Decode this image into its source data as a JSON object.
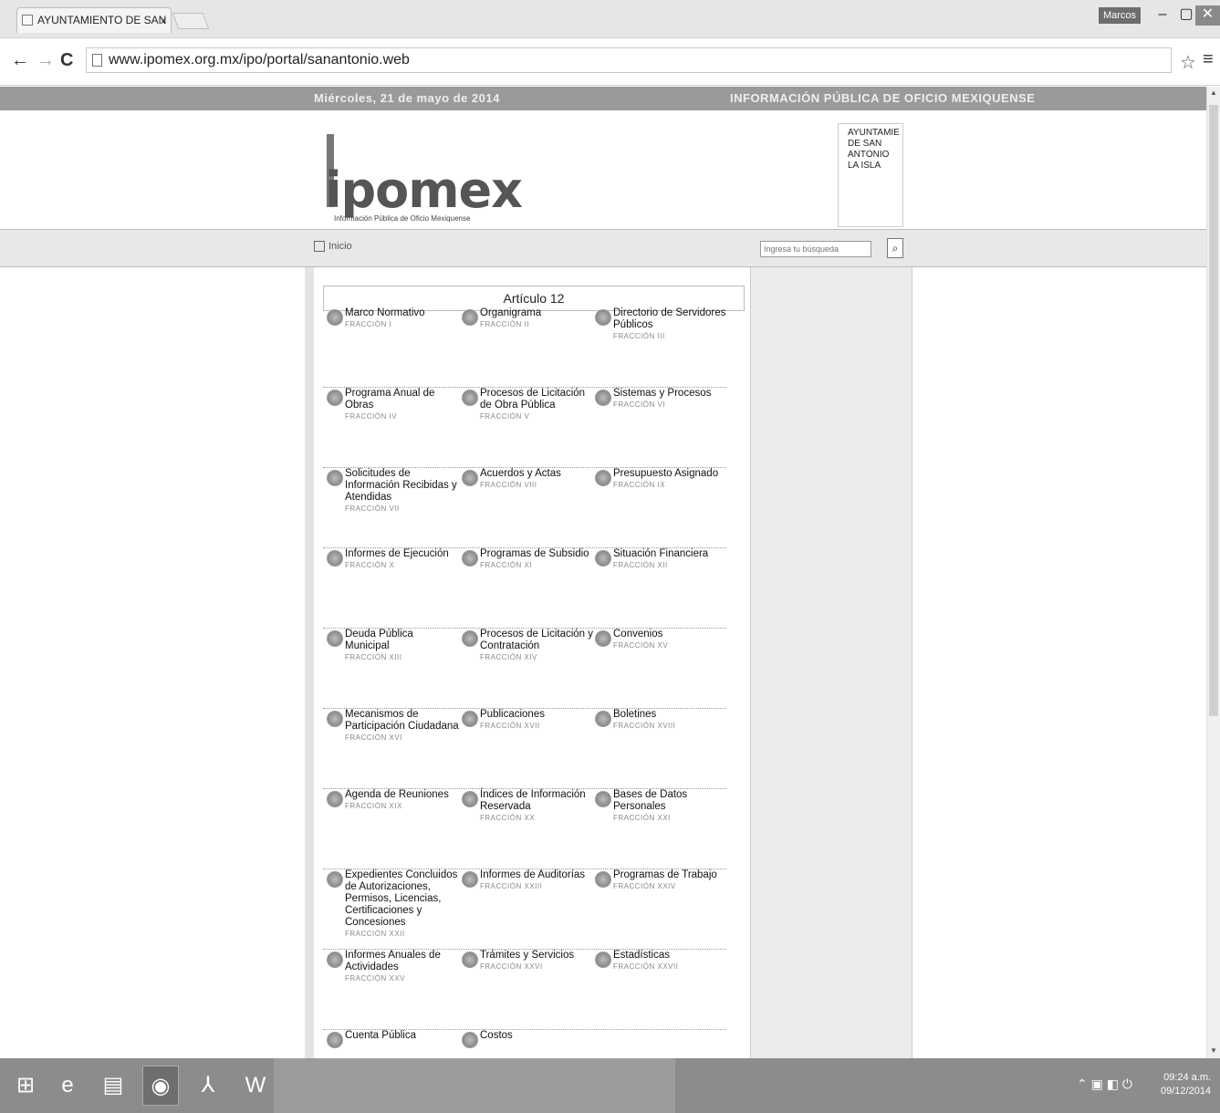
{
  "browser": {
    "tab_title": "AYUNTAMIENTO DE SAN",
    "tab_close": "x",
    "user_badge": "Marcos",
    "url": "www.ipomex.org.mx/ipo/portal/sanantonio.web"
  },
  "header": {
    "band_left": "Miércoles, 21 de mayo de 2014",
    "band_right": "INFORMACIÓN PÚBLICA DE OFICIO MEXIQUENSE",
    "logo": "ipomex",
    "logo_sub": "Información Pública de Oficio Mexiquense",
    "municipality": "AYUNTAMIE DE SAN ANTONIO LA ISLA"
  },
  "nav": {
    "home_label": "Inicio",
    "search_placeholder": "Ingresa tu búsqueda"
  },
  "content": {
    "title": "Artículo 12",
    "rows": [
      [
        {
          "label": "Marco Normativo",
          "fraction": "FRACCIÓN I"
        },
        {
          "label": "Organigrama",
          "fraction": "FRACCIÓN II"
        },
        {
          "label": "Directorio de Servidores Públicos",
          "fraction": "FRACCIÓN III"
        }
      ],
      [
        {
          "label": "Programa Anual de Obras",
          "fraction": "FRACCIÓN IV"
        },
        {
          "label": "Procesos de Licitación de Obra Pública",
          "fraction": "FRACCIÓN V"
        },
        {
          "label": "Sistemas y Procesos",
          "fraction": "FRACCIÓN VI"
        }
      ],
      [
        {
          "label": "Solicitudes de Información Recibidas y Atendidas",
          "fraction": "FRACCIÓN VII"
        },
        {
          "label": "Acuerdos y Actas",
          "fraction": "FRACCIÓN VIII"
        },
        {
          "label": "Presupuesto Asignado",
          "fraction": "FRACCIÓN IX"
        }
      ],
      [
        {
          "label": "Informes de Ejecución",
          "fraction": "FRACCIÓN X"
        },
        {
          "label": "Programas de Subsidio",
          "fraction": "FRACCIÓN XI"
        },
        {
          "label": "Situación Financiera",
          "fraction": "FRACCIÓN XII"
        }
      ],
      [
        {
          "label": "Deuda Pública Municipal",
          "fraction": "FRACCIÓN XIII"
        },
        {
          "label": "Procesos de Licitación y Contratación",
          "fraction": "FRACCIÓN XIV"
        },
        {
          "label": "Convenios",
          "fraction": "FRACCIÓN XV"
        }
      ],
      [
        {
          "label": "Mecanismos de Participación Ciudadana",
          "fraction": "FRACCIÓN XVI"
        },
        {
          "label": "Publicaciones",
          "fraction": "FRACCIÓN XVII"
        },
        {
          "label": "Boletines",
          "fraction": "FRACCIÓN XVIII"
        }
      ],
      [
        {
          "label": "Agenda de Reuniones",
          "fraction": "FRACCIÓN XIX"
        },
        {
          "label": "Índices de Información Reservada",
          "fraction": "FRACCIÓN XX"
        },
        {
          "label": "Bases de Datos Personales",
          "fraction": "FRACCIÓN XXI"
        }
      ],
      [
        {
          "label": "Expedientes Concluidos de Autorizaciones, Permisos, Licencias, Certificaciones y Concesiones",
          "fraction": "FRACCIÓN XXII"
        },
        {
          "label": "Informes de Auditorías",
          "fraction": "FRACCIÓN XXIII"
        },
        {
          "label": "Programas de Trabajo",
          "fraction": "FRACCIÓN XXIV"
        }
      ],
      [
        {
          "label": "Informes Anuales de Actividades",
          "fraction": "FRACCIÓN XXV"
        },
        {
          "label": "Trámites y Servicios",
          "fraction": "FRACCIÓN XXVI"
        },
        {
          "label": "Estadísticas",
          "fraction": "FRACCIÓN XXVII"
        }
      ],
      [
        {
          "label": "Cuenta Pública",
          "fraction": ""
        },
        {
          "label": "Costos",
          "fraction": ""
        }
      ]
    ]
  },
  "taskbar": {
    "clock_time": "09:24 a.m.",
    "clock_date": "09/12/2014"
  }
}
